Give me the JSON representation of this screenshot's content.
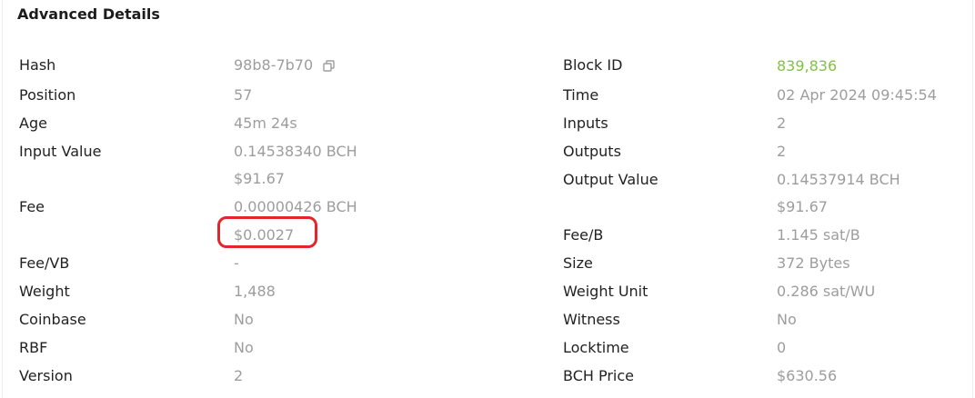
{
  "section": {
    "title": "Advanced Details"
  },
  "left": {
    "hash_label": "Hash",
    "hash_value": "98b8-7b70",
    "position_label": "Position",
    "position_value": "57",
    "age_label": "Age",
    "age_value": "45m 24s",
    "input_value_label": "Input Value",
    "input_value_bch": "0.14538340 BCH",
    "input_value_usd": "$91.67",
    "fee_label": "Fee",
    "fee_bch": "0.00000426 BCH",
    "fee_usd": "$0.0027",
    "fee_vb_label": "Fee/VB",
    "fee_vb_value": "-",
    "weight_label": "Weight",
    "weight_value": "1,488",
    "coinbase_label": "Coinbase",
    "coinbase_value": "No",
    "rbf_label": "RBF",
    "rbf_value": "No",
    "version_label": "Version",
    "version_value": "2"
  },
  "right": {
    "block_id_label": "Block ID",
    "block_id_value": "839,836",
    "time_label": "Time",
    "time_value": "02 Apr 2024 09:45:54",
    "inputs_label": "Inputs",
    "inputs_value": "2",
    "outputs_label": "Outputs",
    "outputs_value": "2",
    "output_value_label": "Output Value",
    "output_value_bch": "0.14537914 BCH",
    "output_value_usd": "$91.67",
    "fee_b_label": "Fee/B",
    "fee_b_value": "1.145 sat/B",
    "size_label": "Size",
    "size_value": "372 Bytes",
    "weight_unit_label": "Weight Unit",
    "weight_unit_value": "0.286 sat/WU",
    "witness_label": "Witness",
    "witness_value": "No",
    "locktime_label": "Locktime",
    "locktime_value": "0",
    "bch_price_label": "BCH Price",
    "bch_price_value": "$630.56"
  },
  "colors": {
    "block_link": "#82c341",
    "annotation": "#e3252c"
  },
  "icons": {
    "copy": "copy-icon"
  }
}
